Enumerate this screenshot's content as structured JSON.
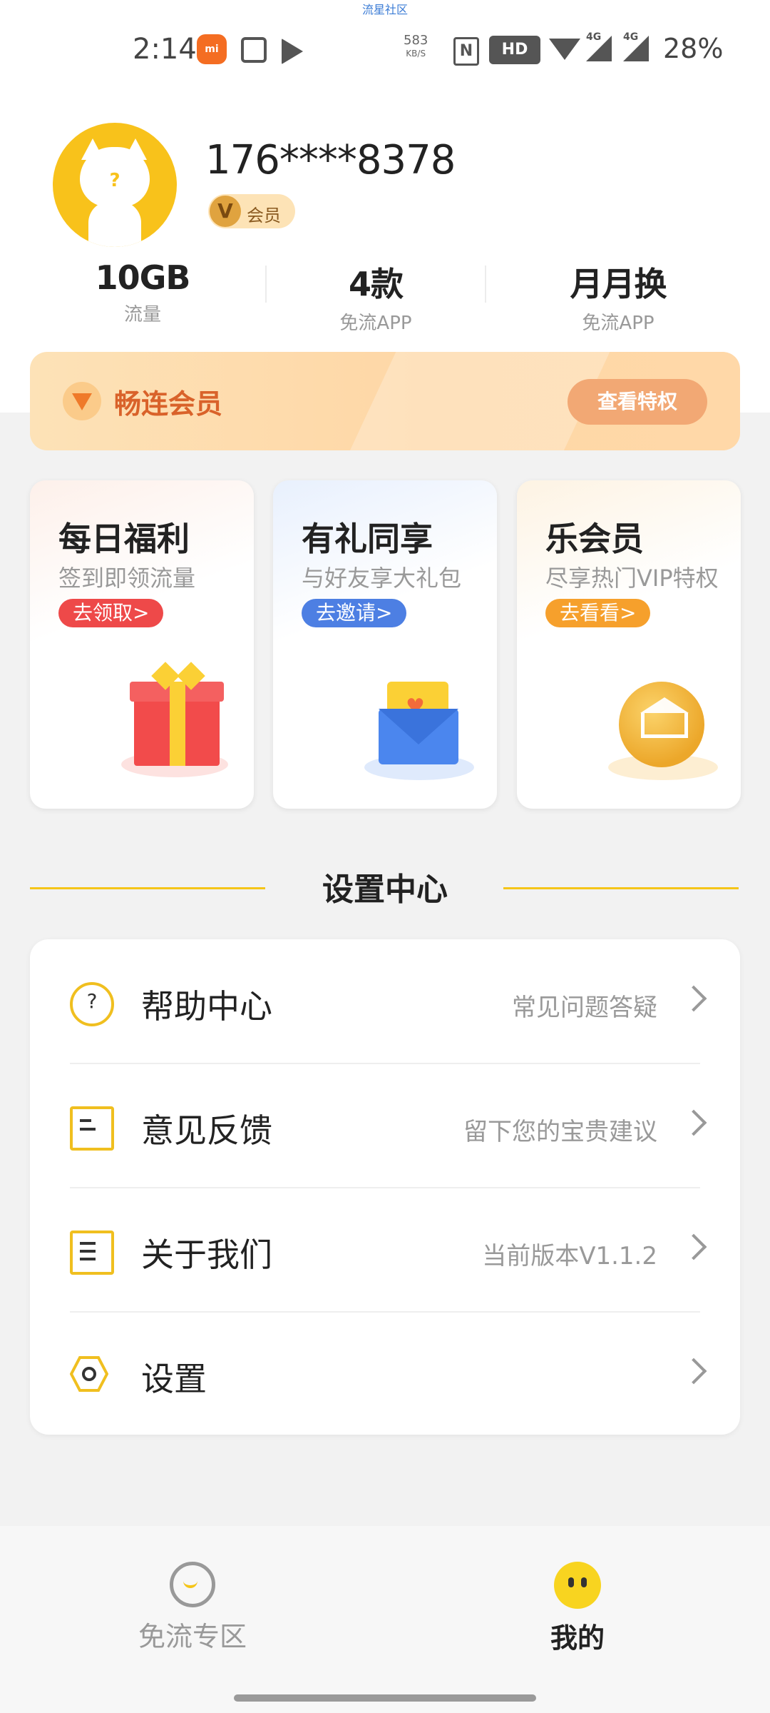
{
  "ticker": "流星社区",
  "status_bar": {
    "time": "2:14",
    "net_speed": "583",
    "net_unit": "KB/S",
    "hd": "HD",
    "net1": "4G",
    "net2": "4G",
    "battery": "28%"
  },
  "profile": {
    "phone": "176****8378",
    "member_badge": "会员"
  },
  "stats": [
    {
      "value": "10GB",
      "label": "流量"
    },
    {
      "value": "4款",
      "label": "免流APP"
    },
    {
      "value": "月月换",
      "label": "免流APP"
    }
  ],
  "banner": {
    "title": "畅连会员",
    "button": "查看特权"
  },
  "cards": [
    {
      "title": "每日福利",
      "subtitle": "签到即领流量",
      "button": "去领取>"
    },
    {
      "title": "有礼同享",
      "subtitle": "与好友享大礼包",
      "button": "去邀请>"
    },
    {
      "title": "乐会员",
      "subtitle": "尽享热门VIP特权",
      "button": "去看看>"
    }
  ],
  "settings_section": {
    "title": "设置中心",
    "rows": [
      {
        "label": "帮助中心",
        "hint": "常见问题答疑"
      },
      {
        "label": "意见反馈",
        "hint": "留下您的宝贵建议"
      },
      {
        "label": "关于我们",
        "hint": "当前版本V1.1.2"
      },
      {
        "label": "设置",
        "hint": ""
      }
    ]
  },
  "bottom_nav": {
    "items": [
      {
        "label": "免流专区",
        "icon": "drop-icon",
        "active": false
      },
      {
        "label": "我的",
        "icon": "face-icon",
        "active": true
      }
    ]
  },
  "colors": {
    "accent": "#f5c518",
    "banner_text": "#d9622a",
    "red_button": "#ee4949",
    "blue_button": "#4d7fe3",
    "orange_button": "#f6a02c"
  }
}
